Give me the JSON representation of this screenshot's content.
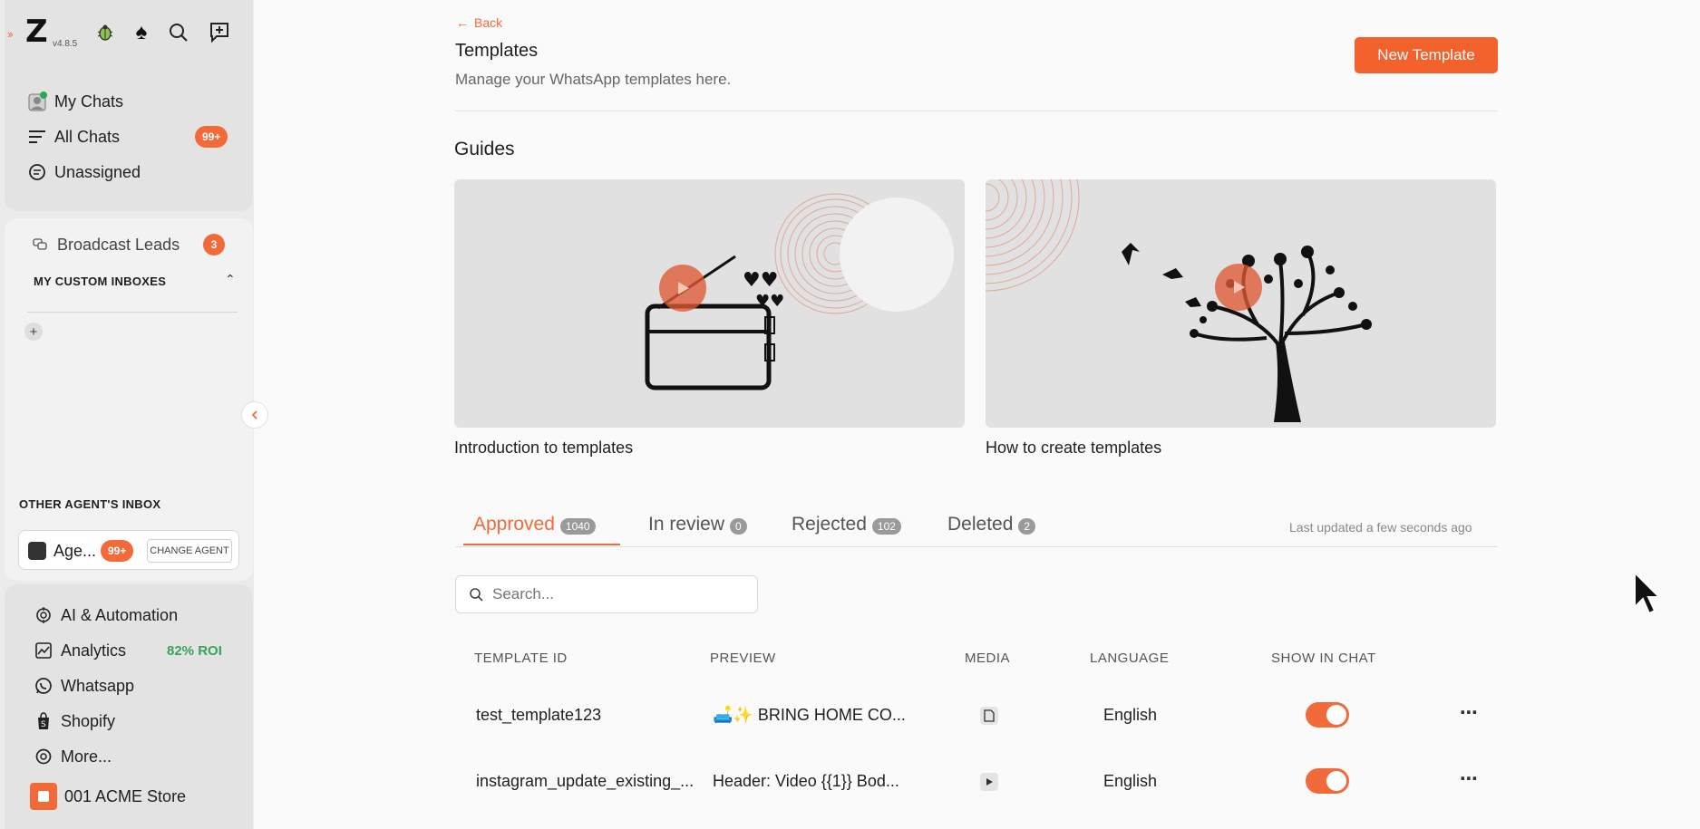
{
  "sidebar": {
    "version": "v4.8.5",
    "nav": {
      "my_chats": "My Chats",
      "all_chats": "All Chats",
      "all_chats_badge": "99+",
      "unassigned": "Unassigned"
    },
    "broadcast_leads": "Broadcast Leads",
    "broadcast_badge": "3",
    "custom_inboxes_label": "MY CUSTOM INBOXES",
    "other_agents_label": "OTHER AGENT'S INBOX",
    "agent": {
      "name": "Age...",
      "badge": "99+",
      "change_label": "CHANGE AGENT"
    },
    "bottom": {
      "ai": "AI & Automation",
      "analytics": "Analytics",
      "roi": "82% ROI",
      "whatsapp": "Whatsapp",
      "shopify": "Shopify",
      "more": "More...",
      "store": "001 ACME Store"
    }
  },
  "header": {
    "back": "Back",
    "title": "Templates",
    "subtitle": "Manage your WhatsApp templates here.",
    "new_template": "New Template"
  },
  "guides": {
    "title": "Guides",
    "cards": [
      {
        "caption": "Introduction to templates"
      },
      {
        "caption": "How to create templates"
      }
    ]
  },
  "tabs": [
    {
      "label": "Approved",
      "count": "1040"
    },
    {
      "label": "In review",
      "count": "0"
    },
    {
      "label": "Rejected",
      "count": "102"
    },
    {
      "label": "Deleted",
      "count": "2"
    }
  ],
  "last_updated": "Last updated a few seconds ago",
  "search": {
    "placeholder": "Search..."
  },
  "table": {
    "headers": [
      "TEMPLATE ID",
      "PREVIEW",
      "MEDIA",
      "LANGUAGE",
      "SHOW IN CHAT"
    ],
    "rows": [
      {
        "id": "test_template123",
        "preview": "🛋️✨ BRING HOME CO...",
        "media": "document-icon",
        "language": "English",
        "show_in_chat": true
      },
      {
        "id": "instagram_update_existing_...",
        "preview": "Header: Video {{1}} Bod...",
        "media": "video-icon",
        "language": "English",
        "show_in_chat": true
      }
    ]
  },
  "colors": {
    "accent": "#f36a3a",
    "roi": "#3aa35b"
  }
}
